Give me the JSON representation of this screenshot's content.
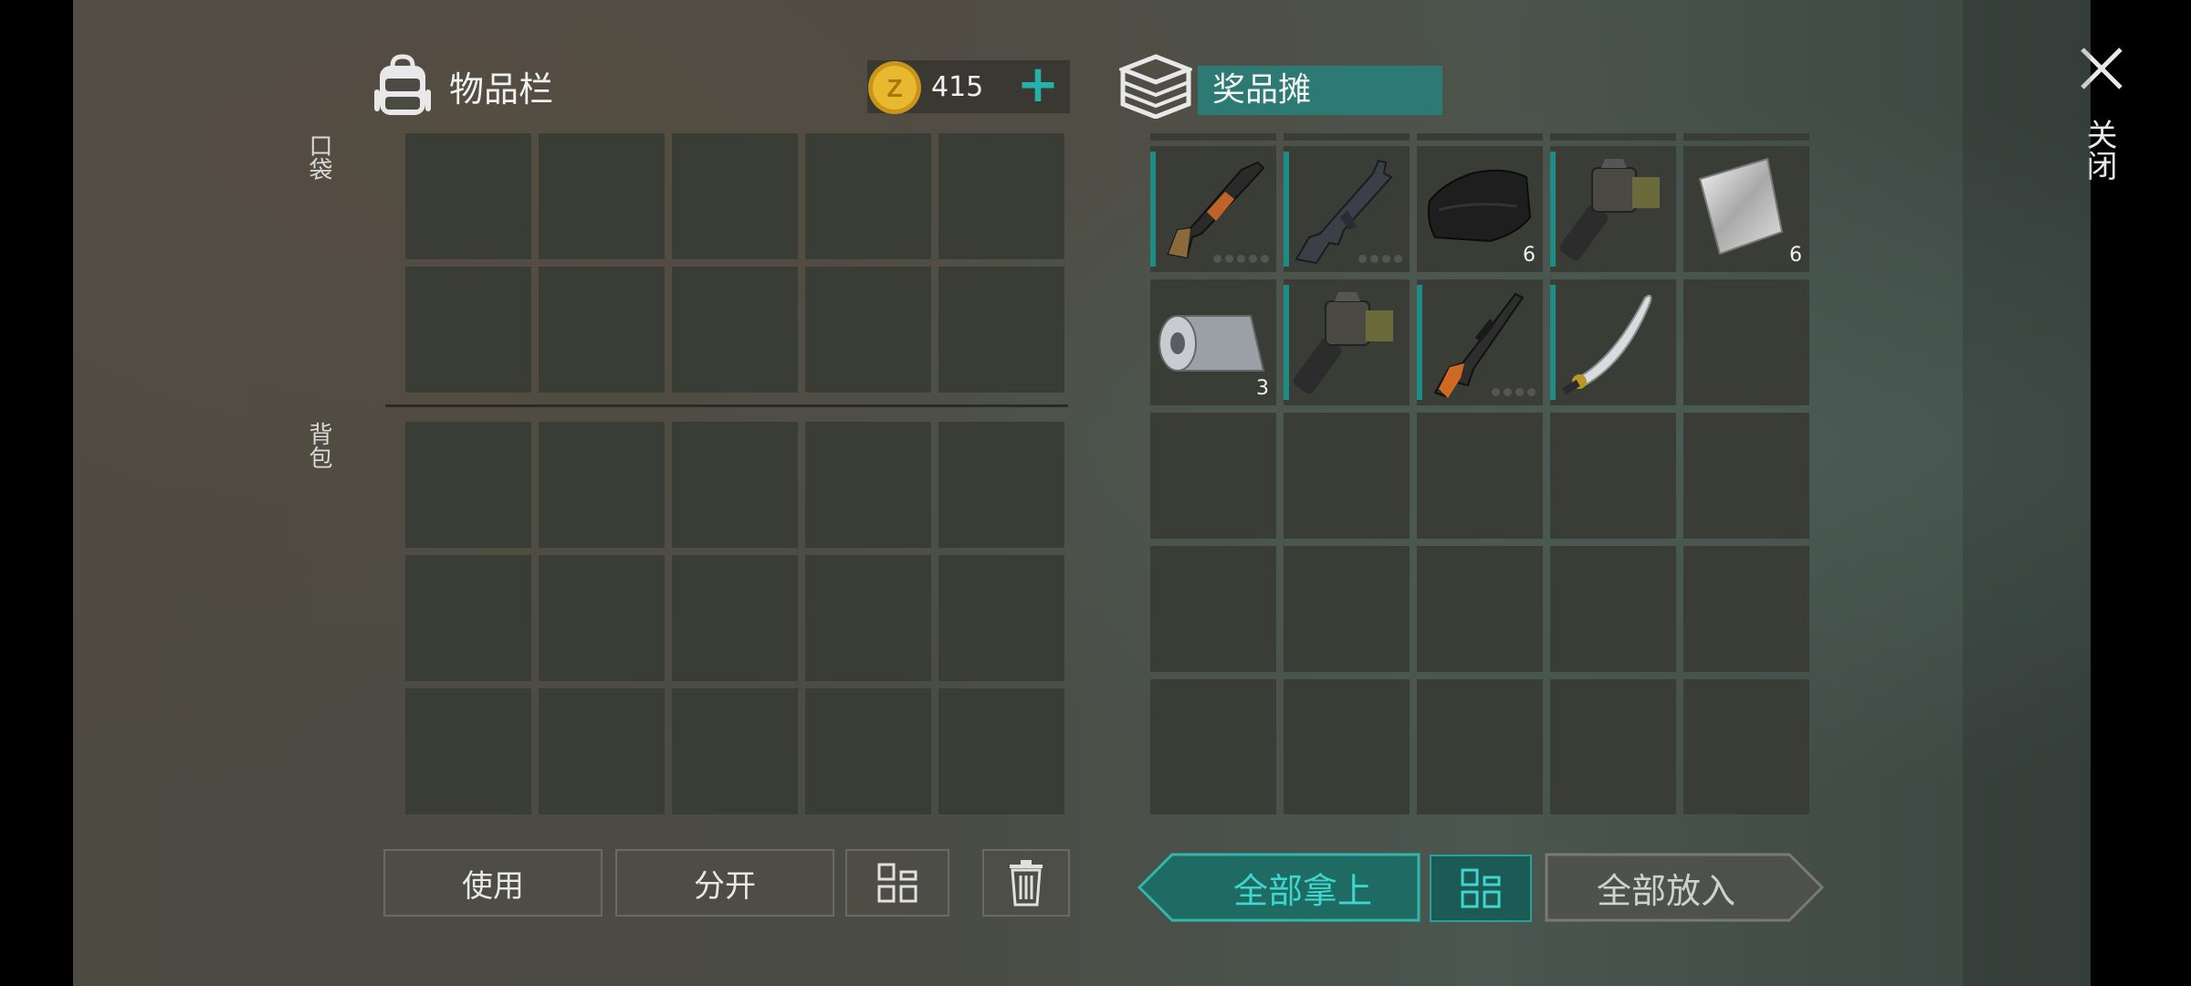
{
  "inventory": {
    "title": "物品栏",
    "coins": "415",
    "pocket_label": "口袋",
    "backpack_label": "背包",
    "pocket_rows": 2,
    "backpack_rows": 3,
    "columns": 5
  },
  "stall": {
    "title": "奖品摊",
    "items": [
      {
        "name": "shotgun",
        "qty": "",
        "durability_dots": 5,
        "teal_marker": true
      },
      {
        "name": "assault-rifle",
        "qty": "",
        "durability_dots": 4,
        "teal_marker": true
      },
      {
        "name": "black-cloth",
        "qty": "6",
        "durability_dots": 0,
        "teal_marker": false
      },
      {
        "name": "grenade-launcher",
        "qty": "",
        "durability_dots": 0,
        "teal_marker": true
      },
      {
        "name": "steel-plate",
        "qty": "6",
        "durability_dots": 0,
        "teal_marker": false
      },
      {
        "name": "metal-roll",
        "qty": "3",
        "durability_dots": 0,
        "teal_marker": false
      },
      {
        "name": "grenade-launcher",
        "qty": "",
        "durability_dots": 0,
        "teal_marker": true
      },
      {
        "name": "sniper-rifle",
        "qty": "",
        "durability_dots": 4,
        "teal_marker": true
      },
      {
        "name": "katana",
        "qty": "",
        "durability_dots": 0,
        "teal_marker": true
      }
    ]
  },
  "close": {
    "label": "关闭"
  },
  "buttons": {
    "use": "使用",
    "split": "分开",
    "take_all": "全部拿上",
    "put_all": "全部放入"
  },
  "colors": {
    "accent": "#27b0a8",
    "stall_header": "#2c7a73",
    "cell": "#3a3c36"
  }
}
